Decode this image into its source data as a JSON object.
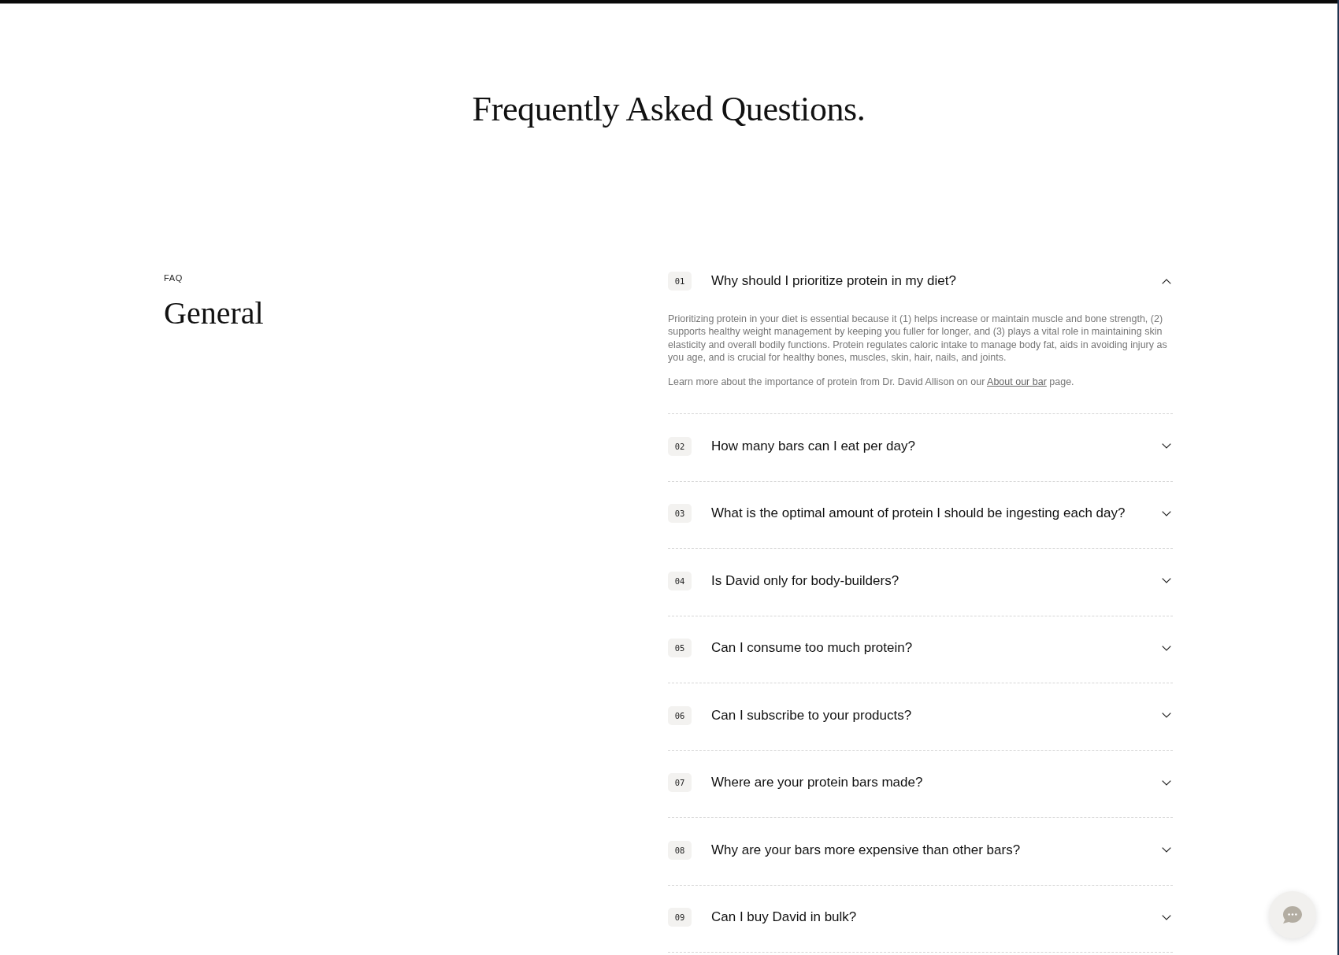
{
  "page_title": "Frequently Asked Questions.",
  "section": {
    "eyebrow": "FAQ",
    "title": "General"
  },
  "faqs": [
    {
      "number": "01",
      "question": "Why should I prioritize protein in my diet?",
      "expanded": true,
      "answer": [
        {
          "segments": [
            {
              "kind": "text",
              "text": "Prioritizing protein in your diet is essential because it (1) helps increase or maintain muscle and bone strength, (2) supports healthy weight management by keeping you fuller for longer, and (3) plays a vital role in maintaining skin elasticity and overall bodily functions. Protein regulates caloric intake to manage body fat, aids in avoiding injury as you age, and is crucial for healthy bones, muscles, skin, hair, nails, and joints."
            }
          ]
        },
        {
          "segments": [
            {
              "kind": "text",
              "text": "Learn more about the importance of protein from Dr. David Allison on our "
            },
            {
              "kind": "link",
              "text": "About our bar"
            },
            {
              "kind": "text",
              "text": " page."
            }
          ]
        }
      ]
    },
    {
      "number": "02",
      "question": "How many bars can I eat per day?",
      "expanded": false
    },
    {
      "number": "03",
      "question": "What is the optimal amount of protein I should be ingesting each day?",
      "expanded": false
    },
    {
      "number": "04",
      "question": "Is David only for body-builders?",
      "expanded": false
    },
    {
      "number": "05",
      "question": "Can I consume too much protein?",
      "expanded": false
    },
    {
      "number": "06",
      "question": "Can I subscribe to your products?",
      "expanded": false
    },
    {
      "number": "07",
      "question": "Where are your protein bars made?",
      "expanded": false
    },
    {
      "number": "08",
      "question": "Why are your bars more expensive than other bars?",
      "expanded": false
    },
    {
      "number": "09",
      "question": "Can I buy David in bulk?",
      "expanded": false
    }
  ]
}
